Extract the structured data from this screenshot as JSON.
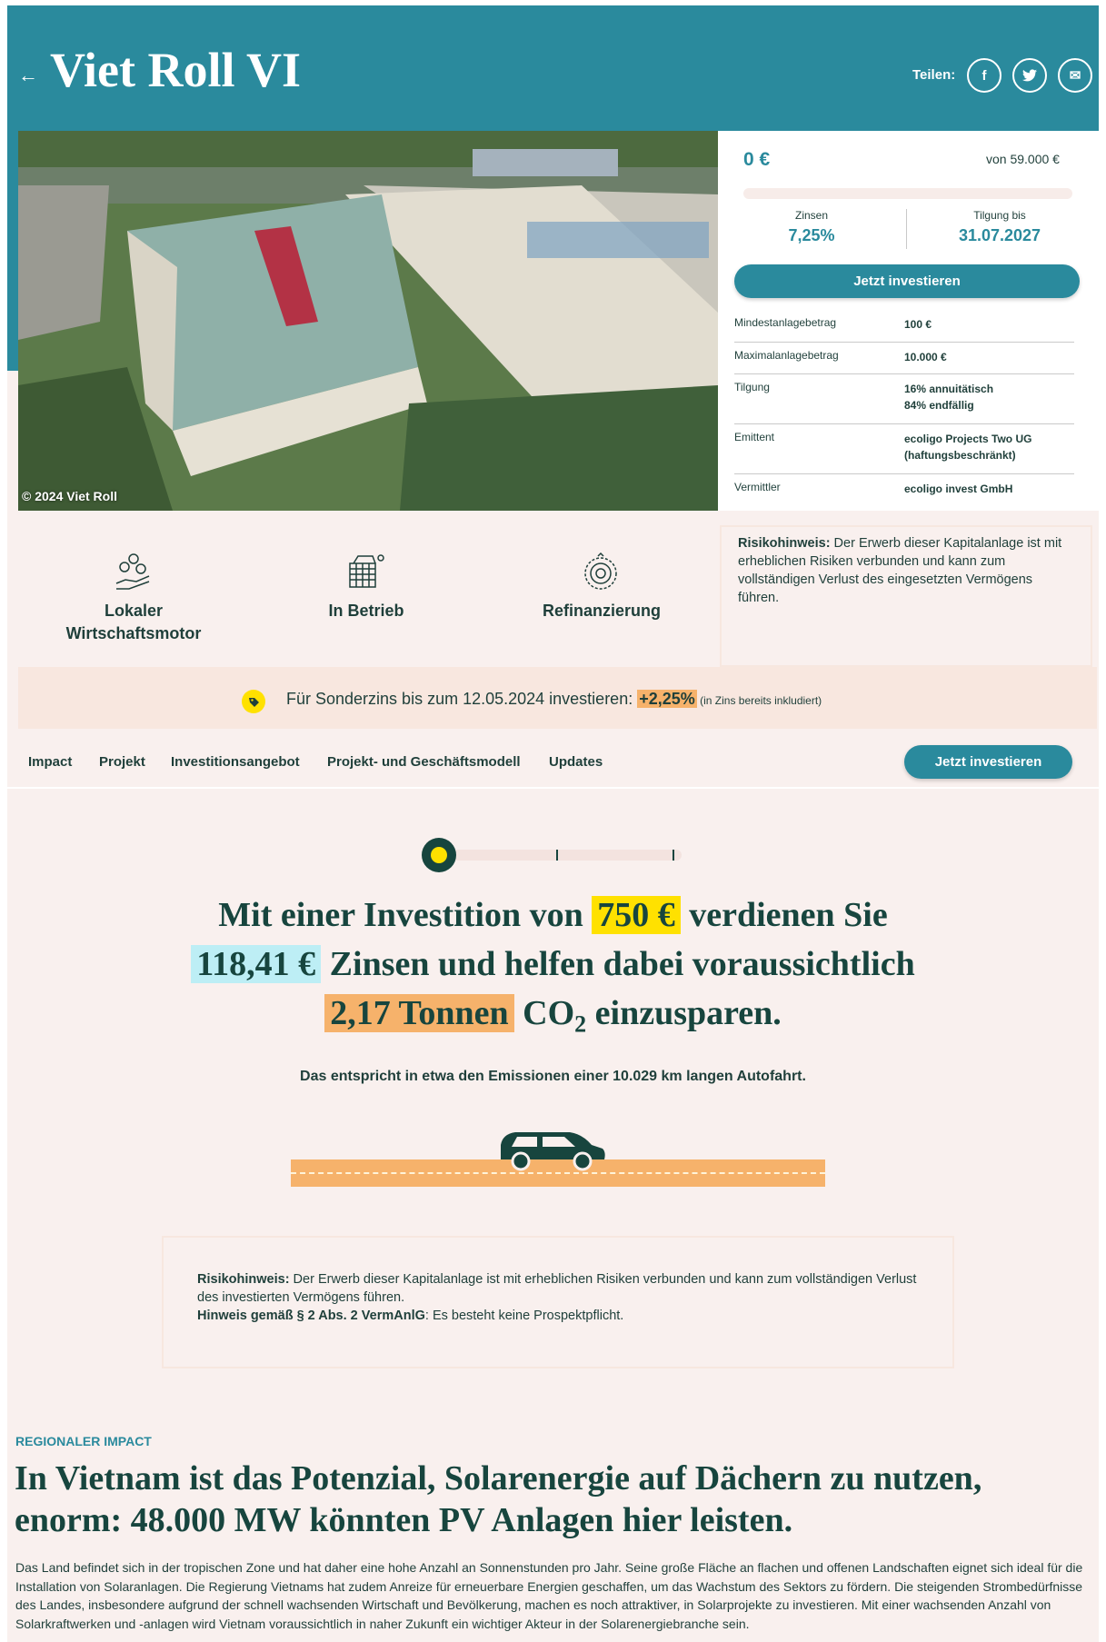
{
  "header": {
    "back_icon": "←",
    "title": "Viet Roll VI",
    "share_label": "Teilen:",
    "share_buttons": [
      {
        "icon": "facebook-icon",
        "glyph": "f"
      },
      {
        "icon": "twitter-icon",
        "glyph": "t"
      },
      {
        "icon": "mail-icon",
        "glyph": "✉"
      }
    ]
  },
  "photo": {
    "credit": "© 2024 Viet Roll"
  },
  "invest_card": {
    "raised": "0 €",
    "target": "von 59.000 €",
    "progress_fraction": 0,
    "interest_label": "Zinsen",
    "interest_value": "7,25%",
    "repayment_label": "Tilgung bis",
    "repayment_value": "31.07.2027",
    "button": "Jetzt investieren",
    "rows": [
      {
        "key": "Mindestanlagebetrag",
        "value": "100 €"
      },
      {
        "key": "Maximalanlagebetrag",
        "value": "10.000 €"
      },
      {
        "key": "Tilgung",
        "value": "16% annuitätisch\n84% endfällig"
      },
      {
        "key": "Emittent",
        "value": "ecoligo Projects Two UG\n(haftungsbeschränkt)"
      },
      {
        "key": "Vermittler",
        "value": "ecoligo invest GmbH"
      }
    ]
  },
  "features": [
    {
      "label": "Lokaler\nWirtschaftsmotor",
      "icon": "economy-icon"
    },
    {
      "label": "In Betrieb",
      "icon": "solar-building-icon"
    },
    {
      "label": "Refinanzierung",
      "icon": "refinance-icon"
    }
  ],
  "risk_note": {
    "bold": "Risikohinweis:",
    "text": " Der Erwerb dieser Kapitalanlage ist mit erheblichen Risiken verbunden und kann zum vollständigen Verlust des eingesetzten Vermögens führen."
  },
  "promo": {
    "text": "Für Sonderzins bis zum 12.05.2024 investieren: ",
    "bonus": "+2,25%",
    "note": " (in Zins bereits inkludiert)",
    "icon": "tag-icon"
  },
  "nav": {
    "items": [
      "Impact",
      "Projekt",
      "Investitionsangebot",
      "Projekt- und Geschäftsmodell",
      "Updates"
    ],
    "button": "Jetzt investieren"
  },
  "calculator": {
    "slider_fraction": 0,
    "line1_pre": "Mit einer Investition von ",
    "amount": "750 €",
    "line1_post": " verdienen Sie",
    "interest": "118,41 €",
    "line2_post": " Zinsen und helfen dabei voraussichtlich",
    "co2_amount": "2,17 Tonnen",
    "co2_pre": " CO",
    "co2_sub": "2",
    "co2_post": " einzusparen.",
    "equivalent": "Das entspricht in etwa den Emissionen einer 10.029 km langen Autofahrt."
  },
  "risk_note2": {
    "bold": "Risikohinweis:",
    "text": " Der Erwerb dieser Kapitalanlage ist mit erheblichen Risiken verbunden und kann zum vollständigen Verlust des investierten Vermögens führen.",
    "bold2": "Hinweis gemäß § 2 Abs. 2 VermAnlG",
    "text2": ": Es besteht keine Prospektpflicht."
  },
  "regional": {
    "eyebrow": "REGIONALER IMPACT",
    "title": "In Vietnam ist das Potenzial, Solarenergie auf Dächern zu nutzen, enorm: 48.000 MW könnten PV Anlagen hier leisten.",
    "body": "Das Land befindet sich in der tropischen Zone und hat daher eine hohe Anzahl an Sonnenstunden pro Jahr. Seine große Fläche an flachen und offenen Landschaften eignet sich ideal für die Installation von Solaranlagen. Die Regierung Vietnams hat zudem Anreize für erneuerbare Energien geschaffen, um das Wachstum des Sektors zu fördern. Die steigenden Strombedürfnisse des Landes, insbesondere aufgrund der schnell wachsenden Wirtschaft und Bevölkerung, machen es noch attraktiver, in Solarprojekte zu investieren. Mit einer wachsenden Anzahl von Solarkraftwerken und -anlagen wird Vietnam voraussichtlich in naher Zukunft ein wichtiger Akteur in der Solarenergiebranche sein."
  }
}
